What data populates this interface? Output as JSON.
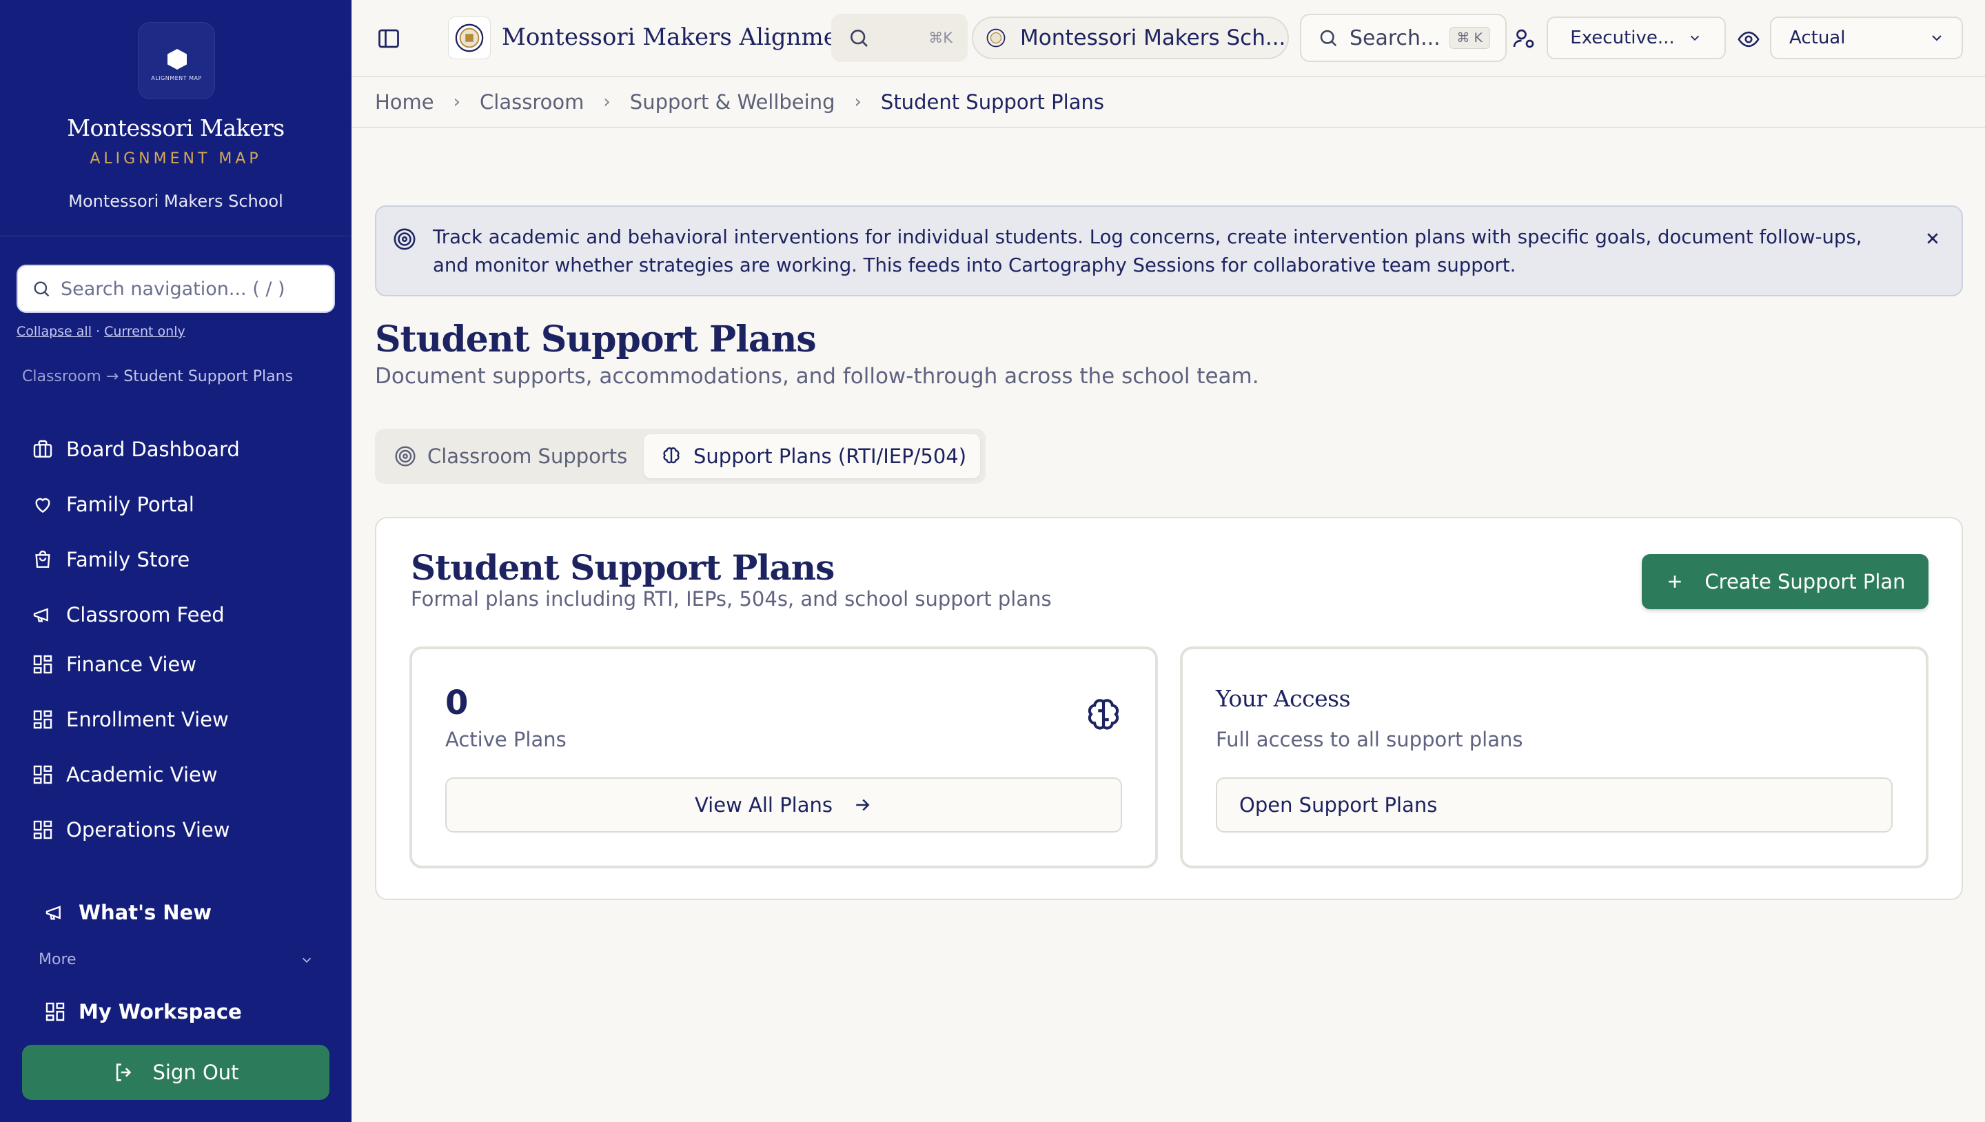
{
  "sidebar": {
    "logo_tag": "ALIGNMENT MAP",
    "brand_name": "Montessori Makers",
    "brand_sub": "ALIGNMENT MAP",
    "school_name": "Montessori Makers School",
    "search_placeholder": "Search navigation... ( / )",
    "collapse_all": "Collapse all",
    "link_separator": "·",
    "current_only": "Current only",
    "crumb_parent": "Classroom",
    "crumb_arrow": "→",
    "crumb_current": "Student Support Plans",
    "items": [
      {
        "label": "Board Dashboard",
        "icon": "briefcase-icon"
      },
      {
        "label": "Family Portal",
        "icon": "heart-icon"
      },
      {
        "label": "Family Store",
        "icon": "shopping-bag-icon"
      },
      {
        "label": "Classroom Feed",
        "icon": "megaphone-icon"
      },
      {
        "label": "Finance View",
        "icon": "dashboard-grid-icon"
      },
      {
        "label": "Enrollment View",
        "icon": "dashboard-grid-icon"
      },
      {
        "label": "Academic View",
        "icon": "dashboard-grid-icon"
      },
      {
        "label": "Operations View",
        "icon": "dashboard-grid-icon"
      }
    ],
    "whats_new": "What's New",
    "more_label": "More",
    "workspace": "My Workspace",
    "sign_out": "Sign Out"
  },
  "topbar": {
    "app_title": "Montessori Makers Alignmen...",
    "command_shortcut": "⌘K",
    "school_selector": "Montessori Makers Sch...",
    "search_label": "Search...",
    "search_shortcut": "⌘ K",
    "role_selector": "Executive...",
    "view_mode": "Actual"
  },
  "breadcrumb": [
    "Home",
    "Classroom",
    "Support & Wellbeing",
    "Student Support Plans"
  ],
  "banner": {
    "text": "Track academic and behavioral interventions for individual students. Log concerns, create intervention plans with specific goals, document follow-ups, and monitor whether strategies are working. This feeds into Cartography Sessions for collaborative team support."
  },
  "page": {
    "title": "Student Support Plans",
    "subtitle": "Document supports, accommodations, and follow-through across the school team."
  },
  "tabs": [
    {
      "label": "Classroom Supports",
      "active": false
    },
    {
      "label": "Support Plans (RTI/IEP/504)",
      "active": true
    }
  ],
  "card": {
    "title": "Student Support Plans",
    "subtitle": "Formal plans including RTI, IEPs, 504s, and school support plans",
    "create_button": "Create Support Plan",
    "stats": {
      "active_count": "0",
      "active_label": "Active Plans",
      "view_button": "View All Plans"
    },
    "access": {
      "title": "Your Access",
      "description": "Full access to all support plans",
      "button": "Open Support Plans"
    }
  },
  "colors": {
    "sidebar_bg": "#141e7c",
    "accent_green": "#2c7c5c",
    "brand_gold": "#d4a952",
    "text_navy": "#1c2360"
  }
}
